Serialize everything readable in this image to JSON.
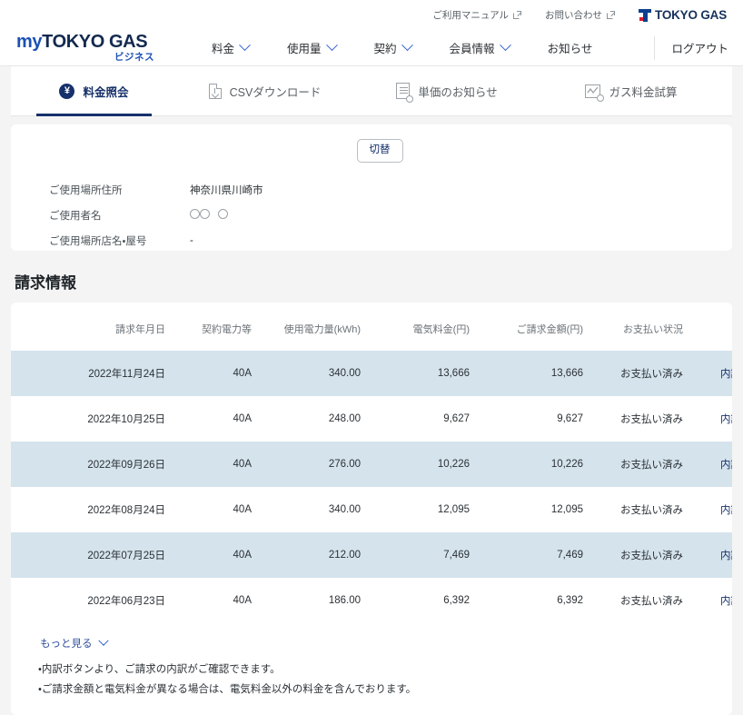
{
  "utility_bar": {
    "links": [
      {
        "label": "ご利用マニュアル",
        "icon": "external-link-icon"
      },
      {
        "label": "お問い合わせ",
        "icon": "external-link-icon"
      }
    ],
    "corp_logo_text": "TOKYO GAS",
    "brand_blue": "#0b3e8f",
    "brand_red": "#d8202f"
  },
  "header": {
    "brand_my": "my",
    "brand_tokyogas": "TOKYO GAS",
    "brand_sub": "ビジネス",
    "nav": [
      {
        "label": "料金",
        "has_dropdown": true
      },
      {
        "label": "使用量",
        "has_dropdown": true
      },
      {
        "label": "契約",
        "has_dropdown": true
      },
      {
        "label": "会員情報",
        "has_dropdown": true
      },
      {
        "label": "お知らせ",
        "has_dropdown": false
      }
    ],
    "logout_label": "ログアウト"
  },
  "tabs": [
    {
      "label": "料金照会",
      "icon": "yen-circle-icon",
      "active": true
    },
    {
      "label": "CSVダウンロード",
      "icon": "document-download-icon",
      "active": false
    },
    {
      "label": "単価のお知らせ",
      "icon": "receipt-icon",
      "active": false
    },
    {
      "label": "ガス料金試算",
      "icon": "chart-line-icon",
      "active": false
    }
  ],
  "info_panel": {
    "switch_button": "切替",
    "rows": [
      {
        "label": "ご使用場所住所",
        "value": "神奈川県川崎市",
        "type": "text"
      },
      {
        "label": "ご使用者名",
        "value": "○○ ○",
        "type": "masked"
      },
      {
        "label": "ご使用場所店名・屋号",
        "value": "-",
        "type": "text"
      }
    ]
  },
  "billing": {
    "section_title": "請求情報",
    "columns": [
      "請求年月日",
      "契約電力等",
      "使用電力量(kWh)",
      "電気料金(円)",
      "ご請求金額(円)",
      "お支払い状況"
    ],
    "detail_label": "内訳",
    "rows": [
      {
        "date": "2022年11月24日",
        "power": "40A",
        "usage": "340.00",
        "fee": "13,666",
        "amount": "13,666",
        "status": "お支払い済み",
        "detail": "内訳"
      },
      {
        "date": "2022年10月25日",
        "power": "40A",
        "usage": "248.00",
        "fee": "9,627",
        "amount": "9,627",
        "status": "お支払い済み",
        "detail": "内訳"
      },
      {
        "date": "2022年09月26日",
        "power": "40A",
        "usage": "276.00",
        "fee": "10,226",
        "amount": "10,226",
        "status": "お支払い済み",
        "detail": "内訳"
      },
      {
        "date": "2022年08月24日",
        "power": "40A",
        "usage": "340.00",
        "fee": "12,095",
        "amount": "12,095",
        "status": "お支払い済み",
        "detail": "内訳"
      },
      {
        "date": "2022年07月25日",
        "power": "40A",
        "usage": "212.00",
        "fee": "7,469",
        "amount": "7,469",
        "status": "お支払い済み",
        "detail": "内訳"
      },
      {
        "date": "2022年06月23日",
        "power": "40A",
        "usage": "186.00",
        "fee": "6,392",
        "amount": "6,392",
        "status": "お支払い済み",
        "detail": "内訳"
      }
    ],
    "more_label": "もっと見る",
    "notes": [
      "・内訳ボタンより、ご請求の内訳がご確認できます。",
      "・ご請求金額と電気料金が異なる場合は、電気料金以外の料金を含んでおります。"
    ]
  },
  "colors": {
    "navy": "#16306b",
    "link_blue": "#2f5fd0",
    "stripe": "#d5e3ec",
    "page_bg": "#f4f4f4"
  }
}
